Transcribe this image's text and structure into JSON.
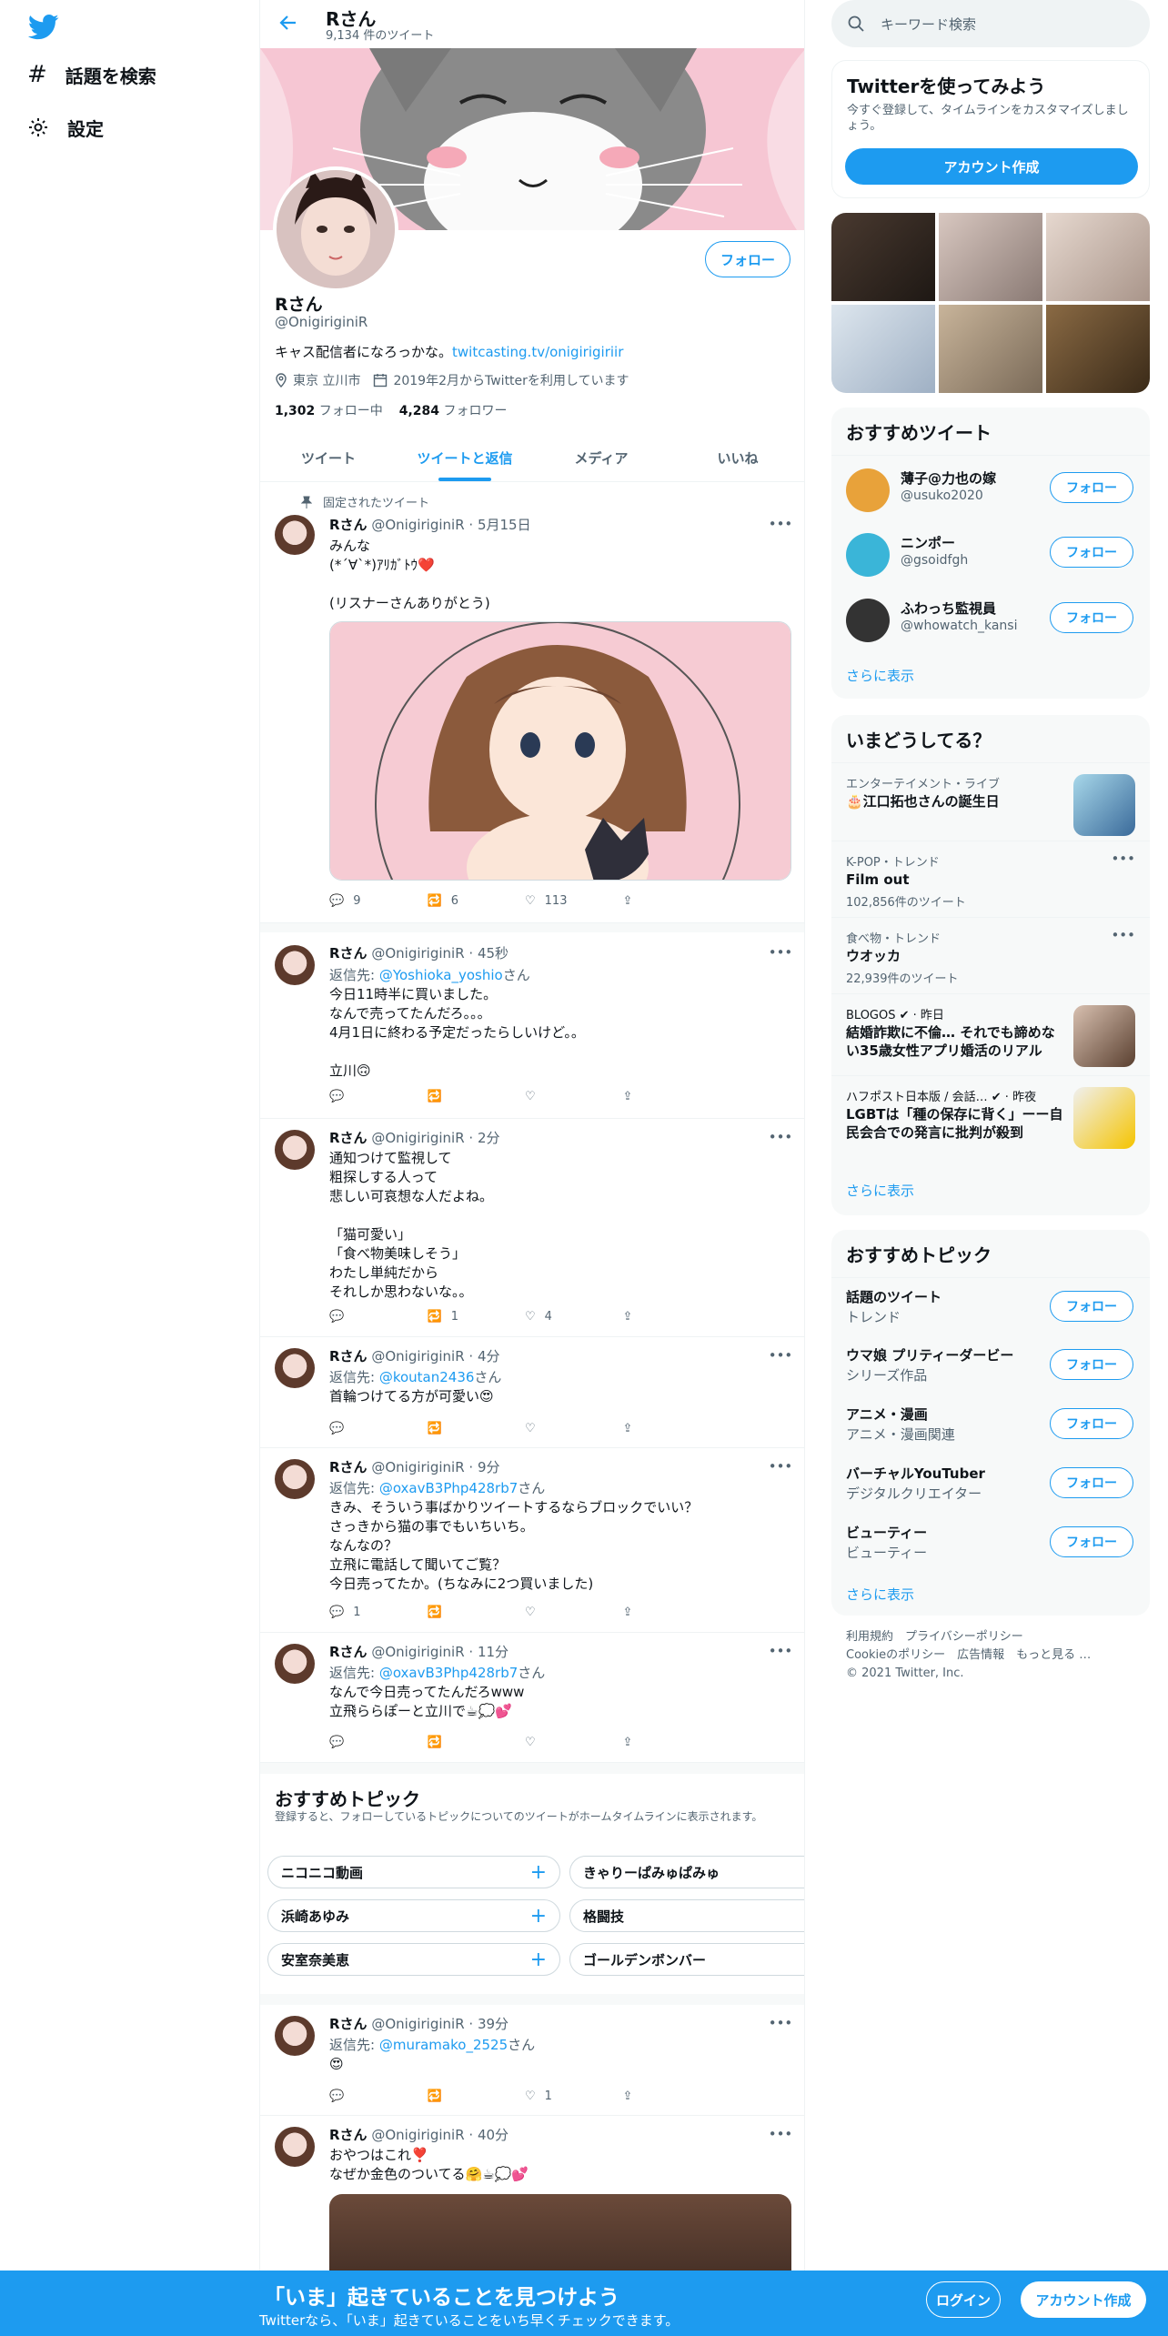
{
  "nav": {
    "explore_label": "話題を検索",
    "settings_label": "設定"
  },
  "header": {
    "title": "Rさん",
    "tweet_count": "9,134 件のツイート"
  },
  "profile": {
    "name": "Rさん",
    "handle": "@OnigiriginiR",
    "bio": "キャス配信者になろっかな。",
    "bio_link": "twitcasting.tv/onigirigiriir",
    "location": "東京 立川市",
    "joined": "2019年2月からTwitterを利用しています",
    "following_count": "1,302",
    "following_label": "フォロー中",
    "followers_count": "4,284",
    "followers_label": "フォロワー",
    "follow_button": "フォロー"
  },
  "tabs": [
    {
      "label": "ツイート"
    },
    {
      "label": "ツイートと返信"
    },
    {
      "label": "メディア"
    },
    {
      "label": "いいね"
    }
  ],
  "pinned_label": "固定されたツイート",
  "tweets": [
    {
      "name": "Rさん",
      "meta": "@OnigiriginiR · 5月15日",
      "text": "みんな\n(*´∀`*)ｱﾘｶﾞﾄｳ❤️\n\n(リスナーさんありがとう)",
      "replies": "9",
      "retweets": "6",
      "likes": "113"
    },
    {
      "name": "Rさん",
      "meta": "@OnigiriginiR · 45秒",
      "reply_prefix": "返信先: ",
      "reply_to": "@Yoshioka_yoshio",
      "reply_suffix": "さん",
      "text": "今日11時半に買いました。\nなんで売ってたんだろ。。。\n4月1日に終わる予定だったらしいけど。。\n\n立川🙃",
      "replies": "",
      "retweets": "",
      "likes": ""
    },
    {
      "name": "Rさん",
      "meta": "@OnigiriginiR · 2分",
      "text": "通知つけて監視して\n粗探しする人って\n悲しい可哀想な人だよね。\n\n「猫可愛い」\n「食べ物美味しそう」\nわたし単純だから\nそれしか思わないな。。",
      "replies": "",
      "retweets": "1",
      "likes": "4"
    },
    {
      "name": "Rさん",
      "meta": "@OnigiriginiR · 4分",
      "reply_prefix": "返信先: ",
      "reply_to": "@koutan2436",
      "reply_suffix": "さん",
      "text": "首輪つけてる方が可愛い😍",
      "replies": "",
      "retweets": "",
      "likes": ""
    },
    {
      "name": "Rさん",
      "meta": "@OnigiriginiR · 9分",
      "reply_prefix": "返信先: ",
      "reply_to": "@oxavB3Php428rb7",
      "reply_suffix": "さん",
      "text": "きみ、そういう事ばかりツイートするならブロックでいい？\nさっきから猫の事でもいちいち。\nなんなの？\n立飛に電話して聞いてご覧？\n今日売ってたか。(ちなみに2つ買いました)",
      "replies": "1",
      "retweets": "",
      "likes": ""
    },
    {
      "name": "Rさん",
      "meta": "@OnigiriginiR · 11分",
      "reply_prefix": "返信先: ",
      "reply_to": "@oxavB3Php428rb7",
      "reply_suffix": "さん",
      "text": "なんで今日売ってたんだろwww\n立飛ららぽーと立川で☕💭💕",
      "replies": "",
      "retweets": "",
      "likes": ""
    },
    {
      "name": "Rさん",
      "meta": "@OnigiriginiR · 39分",
      "reply_prefix": "返信先: ",
      "reply_to": "@muramako_2525",
      "reply_suffix": "さん",
      "text": "😍",
      "replies": "",
      "retweets": "",
      "likes": "1"
    },
    {
      "name": "Rさん",
      "meta": "@OnigiriginiR · 40分",
      "text": "おやつはこれ❣️\nなぜか金色のついてる🤗☕💭💕",
      "replies": "",
      "retweets": "",
      "likes": ""
    }
  ],
  "inline_topics": {
    "title": "おすすめトピック",
    "desc": "登録すると、フォローしているトピックについてのツイートがホームタイムラインに表示されます。",
    "items": [
      {
        "label": "ニコニコ動画"
      },
      {
        "label": "きゃりーぱみゅぱみゅ"
      },
      {
        "label": "浜崎あゆみ"
      },
      {
        "label": "格闘技"
      },
      {
        "label": "安室奈美恵"
      },
      {
        "label": "ゴールデンボンバー"
      }
    ]
  },
  "search": {
    "placeholder": "キーワード検索"
  },
  "signup": {
    "title": "Twitterを使ってみよう",
    "desc": "今すぐ登録して、タイムラインをカスタマイズしましょう。",
    "button": "アカウント作成"
  },
  "recommended": {
    "title": "おすすめツイート",
    "follow_label": "フォロー",
    "users": [
      {
        "name": "薄子@力也の嫁",
        "handle": "@usuko2020"
      },
      {
        "name": "ニンポー",
        "handle": "@gsoidfgh"
      },
      {
        "name": "ふわっち監視員",
        "handle": "@whowatch_kansi"
      }
    ],
    "show_more": "さらに表示"
  },
  "trends": {
    "title": "いまどうしてる？",
    "items": [
      {
        "category": "エンターテイメント・ライブ",
        "title": "🎂江口拓也さんの誕生日",
        "count": ""
      },
      {
        "category": "K-POP・トレンド",
        "title": "Film out",
        "count": "102,856件のツイート"
      },
      {
        "category": "食べ物・トレンド",
        "title": "ウオッカ",
        "count": "22,939件のツイート"
      },
      {
        "category": "BLOGOS ✔ · 昨日",
        "title": "結婚詐欺に不倫… それでも諦めない35歳女性アプリ婚活のリアル",
        "count": ""
      },
      {
        "category": "ハフポスト日本版 / 会話… ✔ · 昨夜",
        "title": "LGBTは「種の保存に背く」ーー自民会合での発言に批判が殺到",
        "count": ""
      }
    ],
    "show_more": "さらに表示"
  },
  "topics": {
    "title": "おすすめトピック",
    "follow_label": "フォロー",
    "items": [
      {
        "name": "話題のツイート",
        "sub": "トレンド"
      },
      {
        "name": "ウマ娘 プリティーダービー",
        "sub": "シリーズ作品"
      },
      {
        "name": "アニメ・漫画",
        "sub": "アニメ・漫画関連"
      },
      {
        "name": "バーチャルYouTuber",
        "sub": "デジタルクリエイター"
      },
      {
        "name": "ビューティー",
        "sub": "ビューティー"
      }
    ],
    "show_more": "さらに表示"
  },
  "footer": {
    "line1": "利用規約　プライバシーポリシー",
    "line2": "Cookieのポリシー　広告情報　もっと見る …",
    "line3": "© 2021 Twitter, Inc."
  },
  "bottom_bar": {
    "title": "「いま」起きていることを見つけよう",
    "subtitle": "Twitterなら、「いま」起きていることをいち早くチェックできます。",
    "login": "ログイン",
    "signup": "アカウント作成"
  },
  "colors": {
    "accent": "#1d9bf0",
    "text": "#0f1419",
    "muted": "#536471",
    "like": "#e0245e"
  }
}
